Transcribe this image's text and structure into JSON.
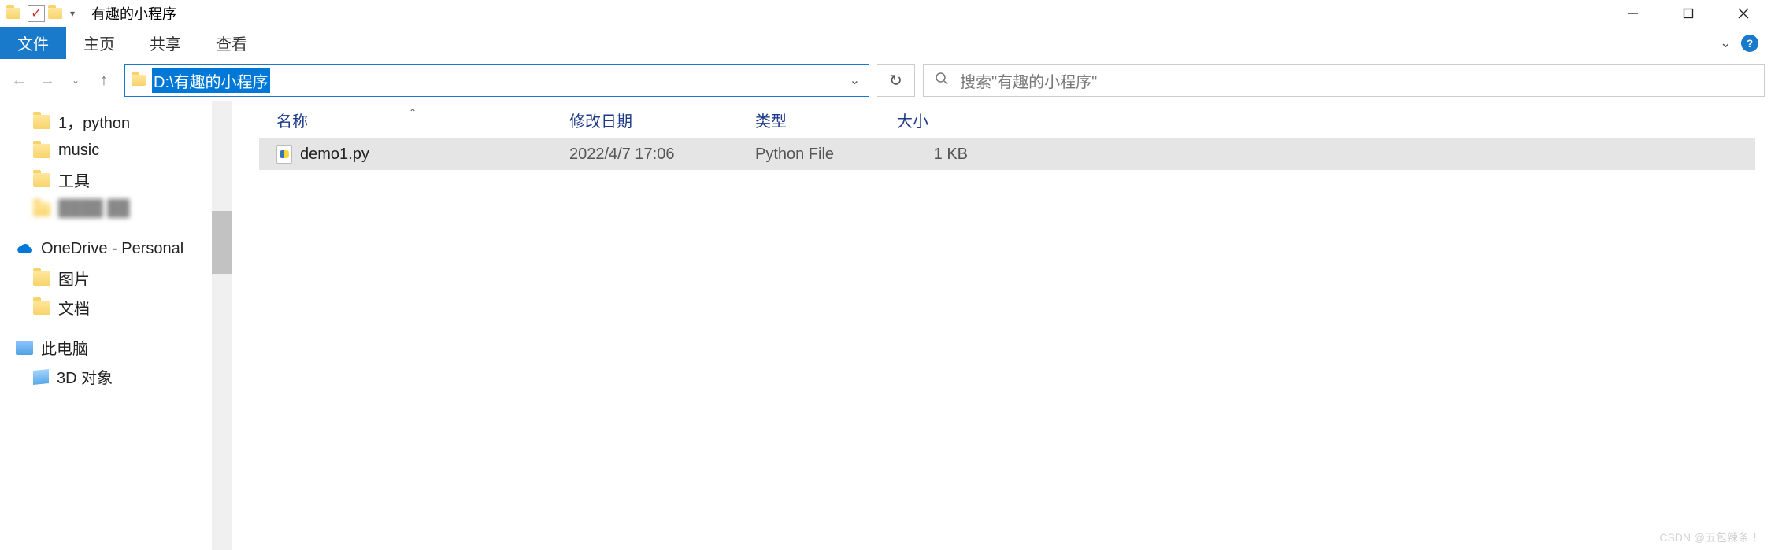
{
  "title": "有趣的小程序",
  "ribbon": {
    "file": "文件",
    "home": "主页",
    "share": "共享",
    "view": "查看"
  },
  "address": {
    "path": "D:\\有趣的小程序"
  },
  "search": {
    "placeholder": "搜索\"有趣的小程序\""
  },
  "navpane": {
    "items": [
      {
        "label": "1，python",
        "icon": "folder"
      },
      {
        "label": "music",
        "icon": "folder"
      },
      {
        "label": "工具",
        "icon": "folder"
      },
      {
        "label": "",
        "icon": "folder",
        "blur": true
      }
    ],
    "onedrive": "OneDrive - Personal",
    "od_children": [
      {
        "label": "图片"
      },
      {
        "label": "文档"
      }
    ],
    "thispc": "此电脑",
    "pc_children": [
      {
        "label": "3D 对象"
      }
    ]
  },
  "columns": {
    "name": "名称",
    "date": "修改日期",
    "type": "类型",
    "size": "大小"
  },
  "files": [
    {
      "name": "demo1.py",
      "date": "2022/4/7 17:06",
      "type": "Python File",
      "size": "1 KB"
    }
  ],
  "watermark": "CSDN @五包辣条 ！"
}
